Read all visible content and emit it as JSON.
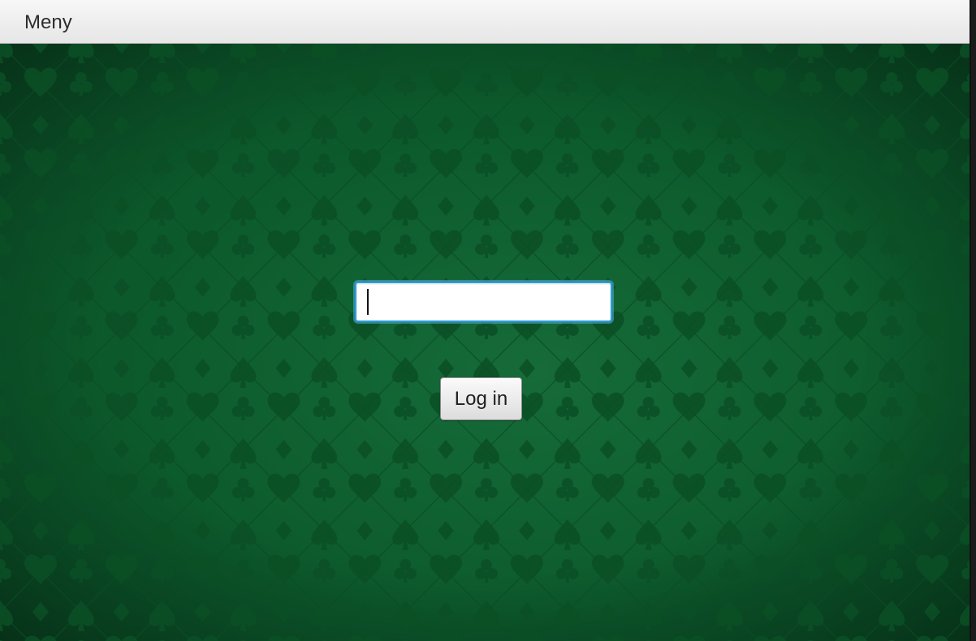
{
  "menubar": {
    "items": [
      {
        "label": "Meny"
      }
    ]
  },
  "login": {
    "username_value": "",
    "username_placeholder": "",
    "button_label": "Log in"
  },
  "colors": {
    "felt": "#0c5a2c",
    "input_focus": "#2a9fd6"
  },
  "background": {
    "pattern": "card-suits"
  }
}
